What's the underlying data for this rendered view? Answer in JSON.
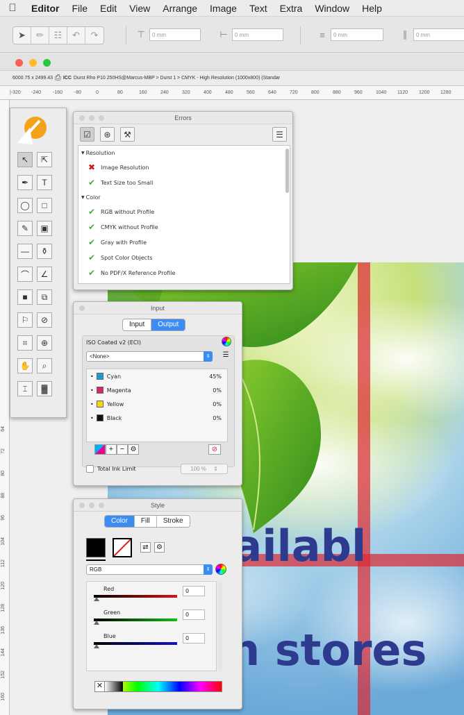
{
  "menubar": {
    "app_name": "Editor",
    "items": [
      "File",
      "Edit",
      "View",
      "Arrange",
      "Image",
      "Text",
      "Extra",
      "Window",
      "Help"
    ]
  },
  "toolbar": {
    "fields": [
      "0 mm",
      "0 mm",
      "0 mm",
      "0 mm"
    ]
  },
  "document": {
    "info": "6000.75 x 2499.43",
    "icc_badge": "ICC",
    "profile_path": "Durst Rho P10 250HS@Marcus-MBP > Durst 1 > CMYK - High Resolution (1000x800) (Standar",
    "ruler_top": [
      "|-320",
      "-240",
      "-160",
      "-80",
      "0",
      "80",
      "160",
      "240",
      "320",
      "400",
      "480",
      "560",
      "640",
      "720",
      "800",
      "880",
      "960",
      "1040",
      "1120",
      "1200",
      "1280"
    ],
    "ruler_left": [
      "64",
      "72",
      "80",
      "88",
      "96",
      "104",
      "112",
      "120",
      "128",
      "136",
      "144",
      "152",
      "160"
    ],
    "artwork_lines": [
      "vailabl",
      "n stores"
    ]
  },
  "errors_panel": {
    "title": "Errors",
    "groups": [
      {
        "name": "Resolution",
        "items": [
          {
            "label": "Image Resolution",
            "status": "error"
          },
          {
            "label": "Text Size too Small",
            "status": "ok"
          }
        ]
      },
      {
        "name": "Color",
        "items": [
          {
            "label": "RGB without Profile",
            "status": "ok"
          },
          {
            "label": "CMYK without Profile",
            "status": "ok"
          },
          {
            "label": "Gray with Profile",
            "status": "ok"
          },
          {
            "label": "Spot Color Objects",
            "status": "ok"
          },
          {
            "label": "No PDF/X Reference Profile",
            "status": "ok"
          }
        ]
      }
    ]
  },
  "input_panel": {
    "title": "Input",
    "tabs": [
      "Input",
      "Output"
    ],
    "active_tab": "Output",
    "profile": "ISO Coated v2 (ECI)",
    "select_value": "<None>",
    "inks": [
      {
        "name": "Cyan",
        "value": "45%",
        "color": "#1f9ad6"
      },
      {
        "name": "Magenta",
        "value": "0%",
        "color": "#d8236f"
      },
      {
        "name": "Yellow",
        "value": "0%",
        "color": "#f1d51a"
      },
      {
        "name": "Black",
        "value": "0%",
        "color": "#111111"
      }
    ],
    "total_ink_label": "Total Ink Limit",
    "total_ink_value": "100 %"
  },
  "style_panel": {
    "title": "Style",
    "tabs": [
      "Color",
      "Fill",
      "Stroke"
    ],
    "active_tab": "Color",
    "color_model": "RGB",
    "channels": [
      {
        "name": "Red",
        "value": "0",
        "color": "#e01010"
      },
      {
        "name": "Green",
        "value": "0",
        "color": "#10c010"
      },
      {
        "name": "Blue",
        "value": "0",
        "color": "#1010d0"
      }
    ]
  },
  "colors": {
    "accent": "#3b8cf3",
    "guide": "#dc2832",
    "artwork_text": "#2e3a8e"
  }
}
